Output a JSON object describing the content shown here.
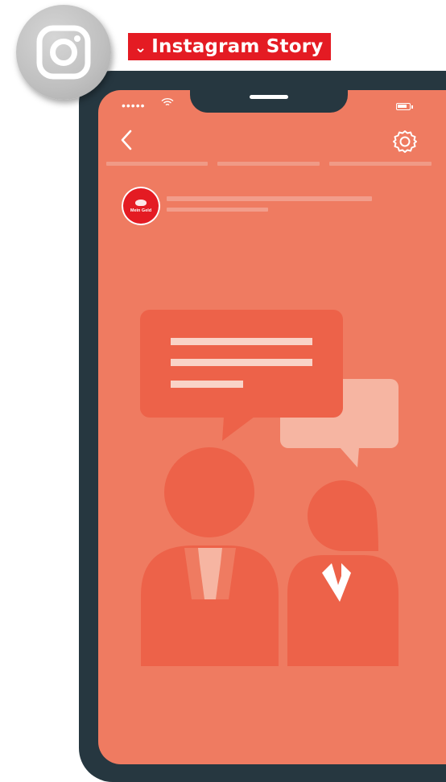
{
  "badge": {
    "icon": "instagram-icon"
  },
  "tag": {
    "label": "Instagram Story",
    "icon": "chevron-down-icon"
  },
  "status": {
    "signal": "•••••",
    "wifi_icon": "wifi-icon",
    "battery_icon": "battery-icon"
  },
  "nav": {
    "back_icon": "chevron-left-icon",
    "settings_icon": "gear-icon"
  },
  "story": {
    "segments": 3,
    "profile_logo_text": "Mein Geld"
  },
  "colors": {
    "screen": "#ef7b61",
    "phone": "#263740",
    "accent": "#e41b23",
    "dark_shape": "#ed6249",
    "light_shape": "#f6b5a2"
  }
}
